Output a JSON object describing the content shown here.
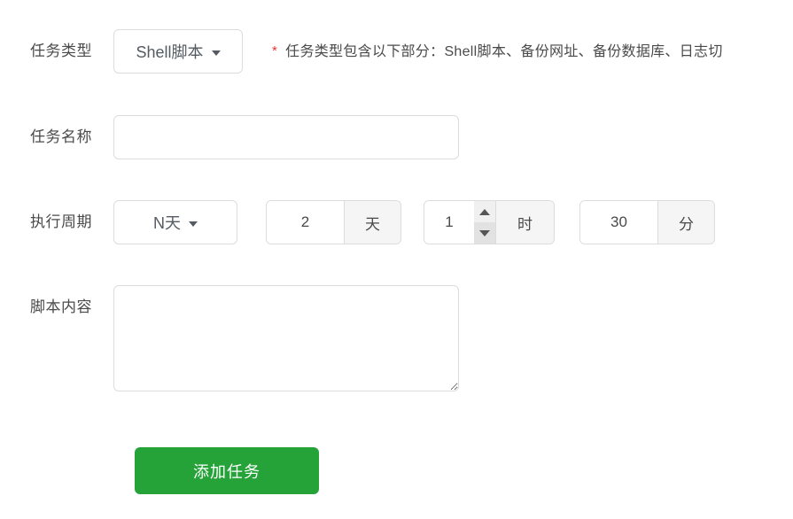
{
  "form": {
    "rows": {
      "task_type": {
        "label": "任务类型",
        "dropdown_value": "Shell脚本",
        "required_mark": "*",
        "hint": "任务类型包含以下部分：Shell脚本、备份网址、备份数据库、日志切"
      },
      "task_name": {
        "label": "任务名称",
        "value": "",
        "placeholder": ""
      },
      "cycle": {
        "label": "执行周期",
        "dropdown_value": "N天",
        "day": {
          "value": "2",
          "unit": "天"
        },
        "hour": {
          "value": "1",
          "unit": "时"
        },
        "minute": {
          "value": "30",
          "unit": "分"
        }
      },
      "script": {
        "label": "脚本内容",
        "value": "",
        "placeholder": ""
      }
    },
    "submit": {
      "label": "添加任务"
    }
  },
  "icons": {
    "caret_down": "caret-down-icon",
    "spinner_up": "spinner-up-icon",
    "spinner_down": "spinner-down-icon"
  },
  "colors": {
    "accent_green": "#25a338",
    "required_red": "#f03030",
    "border": "#dcdcdc",
    "addon_bg": "#f5f5f5",
    "label_text": "#4a4a4a"
  }
}
